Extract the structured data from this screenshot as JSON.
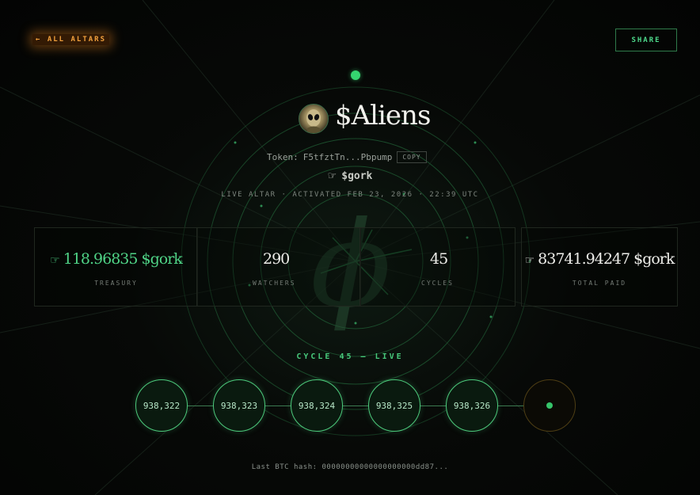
{
  "nav": {
    "back_label": "← ALL ALTARS",
    "share_label": "SHARE"
  },
  "altar": {
    "name": "$Aliens",
    "token_label": "Token:",
    "token_address": "F5tfztTn...Pbpump",
    "copy_label": "COPY",
    "ticker": "$gork",
    "hand_glyph": "☞",
    "status_line": "LIVE ALTAR · ACTIVATED FEB 23, 2026 · 22:39 UTC",
    "symbol": "ϕ"
  },
  "stats": {
    "treasury": {
      "value": "118.96835 $gork",
      "label": "TREASURY"
    },
    "watchers": {
      "value": "290",
      "label": "WATCHERS"
    },
    "cycles": {
      "value": "45",
      "label": "CYCLES"
    },
    "total_paid": {
      "value": "83741.94247 $gork",
      "label": "TOTAL PAID"
    }
  },
  "cycle": {
    "title": "CYCLE 45 — LIVE",
    "blocks": [
      "938,322",
      "938,323",
      "938,324",
      "938,325",
      "938,326"
    ]
  },
  "footer": {
    "hash_line": "Last BTC hash: 00000000000000000000dd87..."
  },
  "colors": {
    "accent_green": "#4fd386",
    "accent_orange": "#f2a13d",
    "background": "#050605"
  }
}
